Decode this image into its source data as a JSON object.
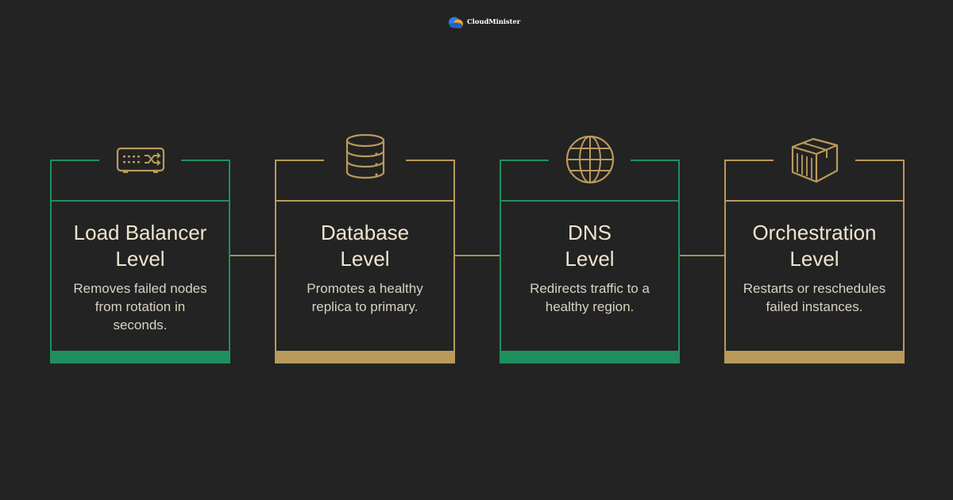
{
  "brand": {
    "name": "CloudMinister"
  },
  "colors": {
    "green": "#1f8f5f",
    "gold": "#b99a5a",
    "connector": "#a8905a"
  },
  "cards": [
    {
      "id": "load-balancer",
      "title": "Load Balancer\nLevel",
      "description": "Removes failed nodes\nfrom rotation in\nseconds.",
      "accent": "green",
      "icon": "load-balancer-icon"
    },
    {
      "id": "database",
      "title": "Database\nLevel",
      "description": "Promotes a healthy\nreplica to primary.",
      "accent": "gold",
      "icon": "database-icon"
    },
    {
      "id": "dns",
      "title": "DNS\nLevel",
      "description": "Redirects traffic to a\nhealthy region.",
      "accent": "green",
      "icon": "globe-icon"
    },
    {
      "id": "orchestration",
      "title": "Orchestration\nLevel",
      "description": "Restarts or reschedules\nfailed instances.",
      "accent": "gold",
      "icon": "container-box-icon"
    }
  ]
}
